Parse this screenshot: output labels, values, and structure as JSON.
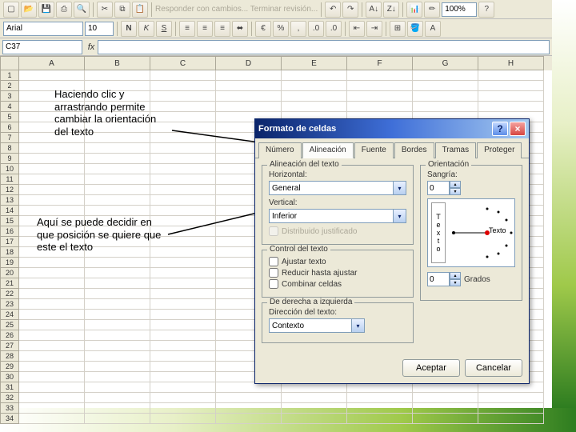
{
  "toolbar": {
    "menu_text": "Responder con cambios...  Terminar revisión...",
    "zoom": "100%"
  },
  "formatbar": {
    "font_name": "Arial",
    "font_size": "10"
  },
  "namebox": {
    "ref": "C37"
  },
  "columns": [
    "A",
    "B",
    "C",
    "D",
    "E",
    "F",
    "G",
    "H"
  ],
  "rows": [
    "1",
    "2",
    "3",
    "4",
    "5",
    "6",
    "7",
    "8",
    "9",
    "10",
    "11",
    "12",
    "13",
    "14",
    "15",
    "16",
    "17",
    "18",
    "19",
    "20",
    "21",
    "22",
    "23",
    "24",
    "25",
    "26",
    "27",
    "28",
    "29",
    "30",
    "31",
    "32",
    "33",
    "34"
  ],
  "annot1": "Haciendo clic y arrastrando permite cambiar la orientación del texto",
  "annot2": "Aquí se puede decidir en que posición se quiere que este el texto",
  "dialog": {
    "title": "Formato de celdas",
    "tabs": [
      "Número",
      "Alineación",
      "Fuente",
      "Bordes",
      "Tramas",
      "Proteger"
    ],
    "align_group": "Alineación del texto",
    "horiz_label": "Horizontal:",
    "horiz_value": "General",
    "indent_label": "Sangría:",
    "indent_value": "0",
    "vert_label": "Vertical:",
    "vert_value": "Inferior",
    "dist_label": "Distribuido justificado",
    "ctrl_group": "Control del texto",
    "wrap_label": "Ajustar texto",
    "shrink_label": "Reducir hasta ajustar",
    "merge_label": "Combinar celdas",
    "rtl_group": "De derecha a izquierda",
    "dir_label": "Dirección del texto:",
    "dir_value": "Contexto",
    "orient_group": "Orientación",
    "orient_vert": "Texto",
    "orient_horiz": "Texto",
    "deg_value": "0",
    "deg_label": "Grados",
    "ok": "Aceptar",
    "cancel": "Cancelar"
  }
}
